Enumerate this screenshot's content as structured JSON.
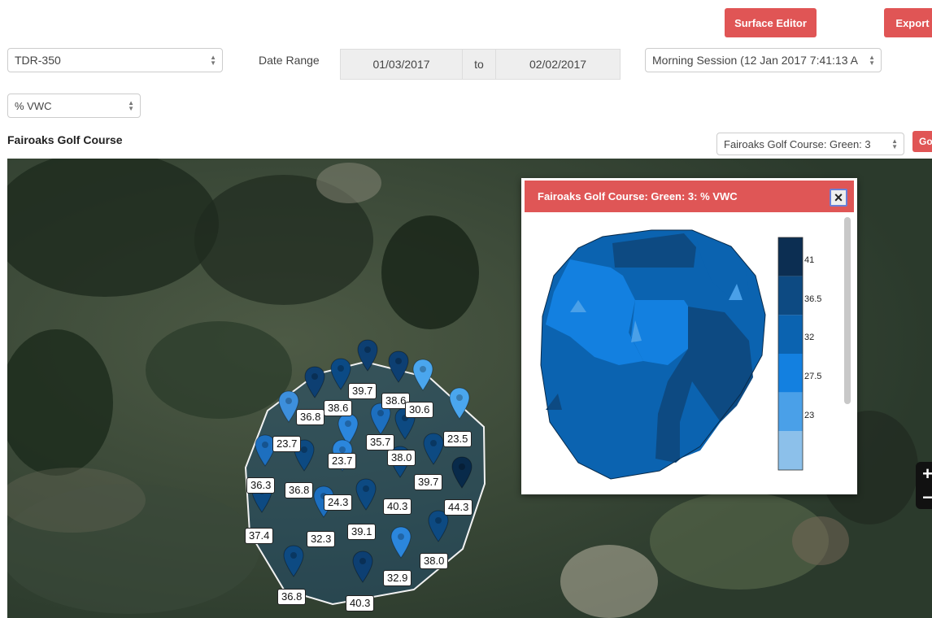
{
  "header": {
    "surface_editor_label": "Surface Editor",
    "export_label": "Export"
  },
  "controls": {
    "device_select": "TDR-350",
    "date_range_label": "Date Range",
    "date_from": "01/03/2017",
    "date_to_label": "to",
    "date_to": "02/02/2017",
    "session_select": "Morning Session (12 Jan 2017 7:41:13 A",
    "metric_select": "% VWC"
  },
  "map_header": {
    "course_title": "Fairoaks Golf Course",
    "green_select": "Fairoaks Golf Course: Green: 3",
    "go_label": "Go"
  },
  "map": {
    "zoom_in": "+",
    "zoom_out": "−",
    "readings": [
      "39.7",
      "38.6",
      "38.6",
      "30.6",
      "36.8",
      "23.7",
      "35.7",
      "23.5",
      "23.7",
      "38.0",
      "36.3",
      "36.8",
      "24.3",
      "39.7",
      "40.3",
      "44.3",
      "37.4",
      "32.3",
      "39.1",
      "38.0",
      "32.9",
      "36.8",
      "40.3"
    ]
  },
  "popup": {
    "title": "Fairoaks Golf Course: Green: 3: % VWC",
    "close_label": "×",
    "legend_ticks": [
      "41",
      "36.5",
      "32",
      "27.5",
      "23"
    ],
    "legend_colors": [
      "#0c2e52",
      "#0d4a82",
      "#0b63b0",
      "#1380e0",
      "#4aa0e8",
      "#8cc0ea"
    ]
  }
}
